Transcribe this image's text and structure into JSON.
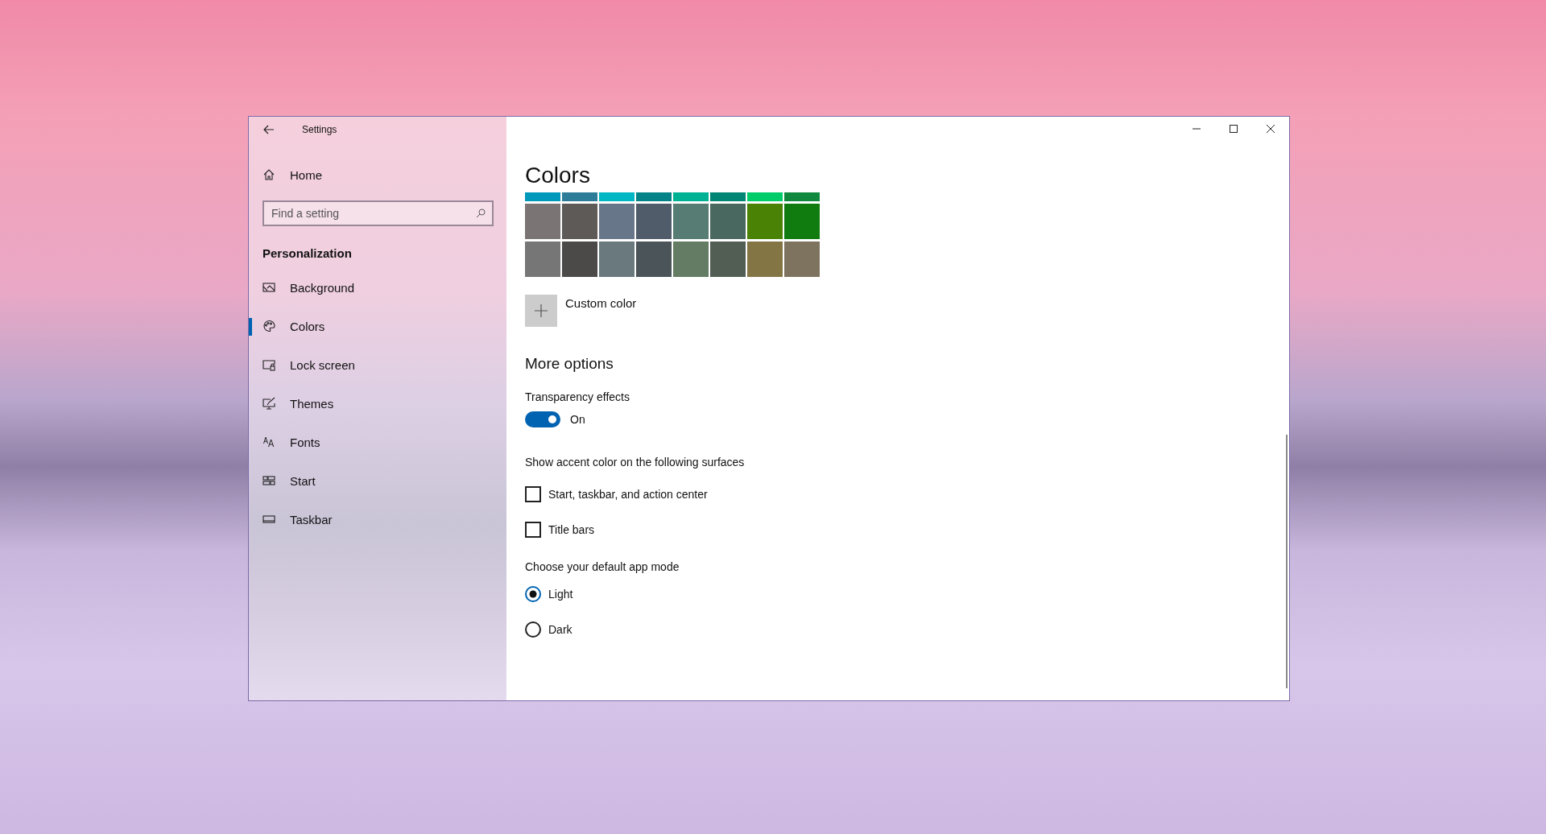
{
  "window": {
    "title": "Settings"
  },
  "sidebar": {
    "home": "Home",
    "search": {
      "placeholder": "Find a setting"
    },
    "section": "Personalization",
    "items": [
      {
        "label": "Background",
        "selected": false
      },
      {
        "label": "Colors",
        "selected": true
      },
      {
        "label": "Lock screen",
        "selected": false
      },
      {
        "label": "Themes",
        "selected": false
      },
      {
        "label": "Fonts",
        "selected": false
      },
      {
        "label": "Start",
        "selected": false
      },
      {
        "label": "Taskbar",
        "selected": false
      }
    ]
  },
  "content": {
    "title": "Colors",
    "swatch_rows": [
      [
        {
          "color": "#0099bc"
        },
        {
          "color": "#2d7d9a"
        },
        {
          "color": "#00b7c3"
        },
        {
          "color": "#038387"
        },
        {
          "color": "#00b294"
        },
        {
          "color": "#018574"
        },
        {
          "color": "#00cc6a"
        },
        {
          "color": "#10893e"
        }
      ],
      [
        {
          "color": "#7a7574"
        },
        {
          "color": "#5d5a58"
        },
        {
          "color": "#68768a"
        },
        {
          "color": "#515c6b"
        },
        {
          "color": "#567c73"
        },
        {
          "color": "#486860"
        },
        {
          "color": "#498205"
        },
        {
          "color": "#107c10"
        }
      ],
      [
        {
          "color": "#767676"
        },
        {
          "color": "#4c4a48"
        },
        {
          "color": "#69797e"
        },
        {
          "color": "#4a5459"
        },
        {
          "color": "#647c64"
        },
        {
          "color": "#525e54"
        },
        {
          "color": "#847545"
        },
        {
          "color": "#7e735f"
        }
      ]
    ],
    "custom_color": "Custom color",
    "more_options": "More options",
    "transparency": {
      "label": "Transparency effects",
      "on": true,
      "state_text": "On"
    },
    "accent_surfaces": {
      "label": "Show accent color on the following surfaces",
      "options": [
        {
          "label": "Start, taskbar, and action center",
          "checked": false
        },
        {
          "label": "Title bars",
          "checked": false
        }
      ]
    },
    "app_mode": {
      "label": "Choose your default app mode",
      "options": [
        {
          "label": "Light",
          "selected": true
        },
        {
          "label": "Dark",
          "selected": false
        }
      ]
    }
  }
}
